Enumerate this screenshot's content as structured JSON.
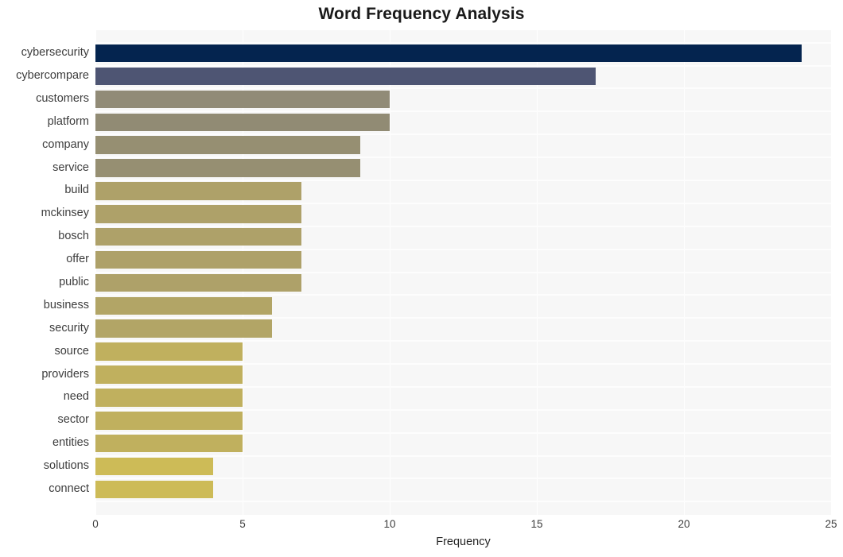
{
  "chart_data": {
    "type": "bar",
    "orientation": "horizontal",
    "title": "Word Frequency Analysis",
    "xlabel": "Frequency",
    "ylabel": "",
    "categories": [
      "cybersecurity",
      "cybercompare",
      "customers",
      "platform",
      "company",
      "service",
      "build",
      "mckinsey",
      "bosch",
      "offer",
      "public",
      "business",
      "security",
      "source",
      "providers",
      "need",
      "sector",
      "entities",
      "solutions",
      "connect"
    ],
    "values": [
      24,
      17,
      10,
      10,
      9,
      9,
      7,
      7,
      7,
      7,
      7,
      6,
      6,
      5,
      5,
      5,
      5,
      5,
      4,
      4
    ],
    "bar_colors": [
      "#04244f",
      "#4e5573",
      "#918b77",
      "#918b74",
      "#968f72",
      "#968f72",
      "#aea169",
      "#aea169",
      "#aea169",
      "#aea169",
      "#aea169",
      "#b2a566",
      "#b2a566",
      "#c0b05e",
      "#c0b05e",
      "#c0b05e",
      "#c0b05e",
      "#c0b05e",
      "#cdbb57",
      "#cdbb57"
    ],
    "xlim": [
      0,
      25
    ],
    "xticks": [
      0,
      5,
      10,
      15,
      20,
      25
    ],
    "xtick_labels": [
      "0",
      "5",
      "10",
      "15",
      "20",
      "25"
    ],
    "grid": "vertical-and-horizontal-white",
    "plot_background": "#f7f7f7",
    "figure_background": "#ffffff",
    "legend": null
  }
}
